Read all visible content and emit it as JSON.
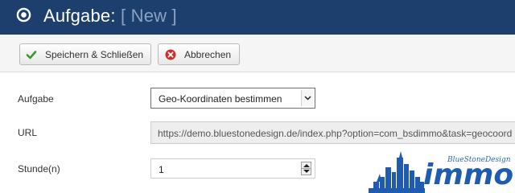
{
  "header": {
    "title": "Aufgabe:",
    "state": "[ New ]",
    "icon": "target-icon",
    "background": "#1d3f6d"
  },
  "toolbar": {
    "save_close_label": "Speichern & Schließen",
    "save_close_icon": "checkmark-icon",
    "cancel_label": "Abbrechen",
    "cancel_icon": "cancel-circle-icon"
  },
  "form": {
    "task": {
      "label": "Aufgabe",
      "selected": "Geo-Koordinaten bestimmen"
    },
    "url": {
      "label": "URL",
      "value": "https://demo.bluestonedesign.de/index.php?option=com_bsdimmo&task=geocoord"
    },
    "hours": {
      "label": "Stunde(n)",
      "value": "1"
    }
  },
  "logo": {
    "brand": "BlueStoneDesign",
    "word": "immo",
    "color": "#1f5bae"
  }
}
